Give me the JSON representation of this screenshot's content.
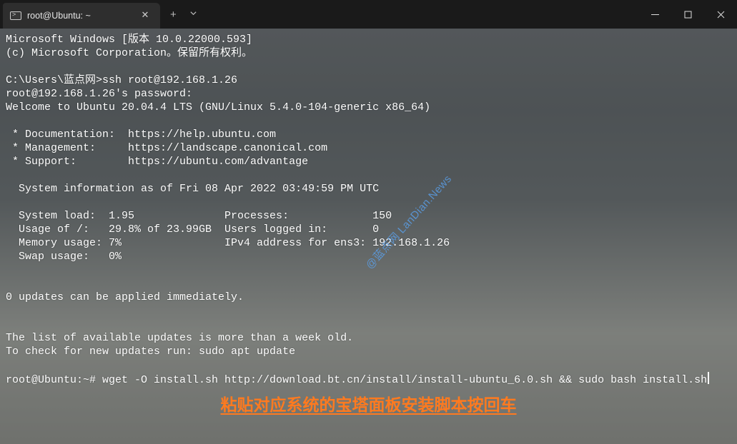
{
  "tab": {
    "title": "root@Ubuntu: ~"
  },
  "terminal": {
    "l01": "Microsoft Windows [版本 10.0.22000.593]",
    "l02": "(c) Microsoft Corporation。保留所有权利。",
    "l03": "",
    "l04": "C:\\Users\\蓝点网>ssh root@192.168.1.26",
    "l05": "root@192.168.1.26's password:",
    "l06": "Welcome to Ubuntu 20.04.4 LTS (GNU/Linux 5.4.0-104-generic x86_64)",
    "l07": "",
    "l08": " * Documentation:  https://help.ubuntu.com",
    "l09": " * Management:     https://landscape.canonical.com",
    "l10": " * Support:        https://ubuntu.com/advantage",
    "l11": "",
    "l12": "  System information as of Fri 08 Apr 2022 03:49:59 PM UTC",
    "l13": "",
    "l14": "  System load:  1.95              Processes:             150",
    "l15": "  Usage of /:   29.8% of 23.99GB  Users logged in:       0",
    "l16": "  Memory usage: 7%                IPv4 address for ens3: 192.168.1.26",
    "l17": "  Swap usage:   0%",
    "l18": "",
    "l19": "",
    "l20": "0 updates can be applied immediately.",
    "l21": "",
    "l22": "",
    "l23": "The list of available updates is more than a week old.",
    "l24": "To check for new updates run: sudo apt update",
    "l25": "",
    "l26": "root@Ubuntu:~# wget -O install.sh http://download.bt.cn/install/install-ubuntu_6.0.sh && sudo bash install.sh"
  },
  "watermark": "@蓝点网 LanDian.News",
  "annotation": "粘贴对应系统的宝塔面板安装脚本按回车"
}
